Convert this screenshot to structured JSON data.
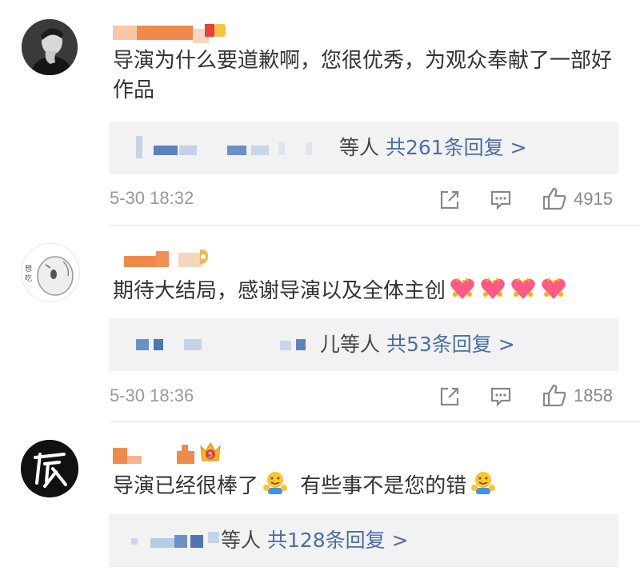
{
  "comments": [
    {
      "text": "导演为什么要道歉啊，您很优秀，为观众奉献了一部好作品",
      "reply_suffix": "等人",
      "reply_link": "共261条回复 >",
      "time": "5-30 18:32",
      "likes": "4915",
      "avatar_icon": "photo-man-hand-on-chin",
      "badge_icon": "level-badge-icon"
    },
    {
      "text": "期待大结局，感谢导演以及全体主创",
      "emojis": [
        "heart-emoji",
        "heart-emoji",
        "heart-emoji",
        "heart-emoji"
      ],
      "reply_suffix": "儿等人",
      "reply_link": "共53条回复 >",
      "time": "5-30 18:36",
      "likes": "1858",
      "avatar_icon": "cartoon-parrot-avatar",
      "badge_icon": "level-badge-icon"
    },
    {
      "text_a": "导演已经很棒了",
      "text_b": "有些事不是您的错",
      "emojis": [
        "hug-emoji",
        "hug-emoji"
      ],
      "reply_suffix": "等人",
      "reply_link": "共128条回复 >",
      "avatar_icon": "calligraphy-logo-avatar",
      "badge_icon": "crown-level-badge",
      "badge_level": "5"
    }
  ],
  "colors": {
    "link": "#4a6ea8",
    "text": "#333333",
    "meta": "#999999",
    "reply_bg": "#f2f2f2",
    "masked_name": "#f08a4b",
    "masked_reply": "#4a78b8"
  },
  "actions": [
    "share-icon",
    "comment-icon",
    "thumbs-up-icon"
  ]
}
